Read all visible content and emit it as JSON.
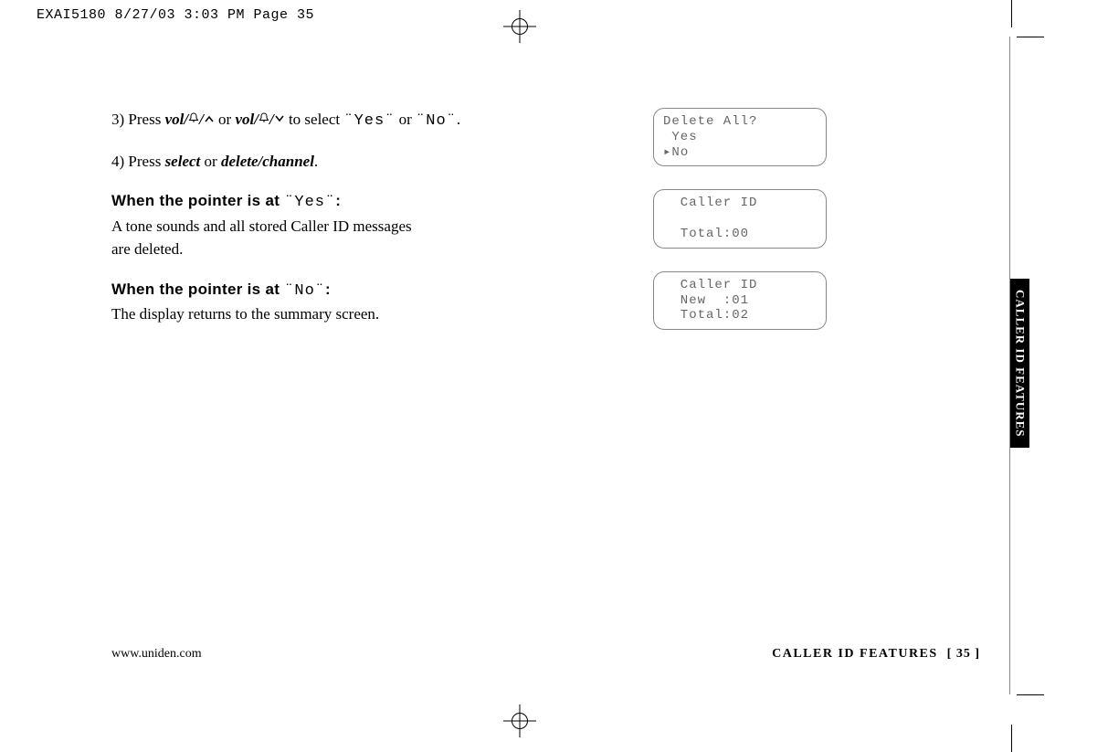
{
  "slug": "EXAI5180  8/27/03 3:03 PM  Page 35",
  "step3_prefix": "3) Press ",
  "vol_label": "vol/",
  "step3_mid": " or ",
  "step3_suffix_a": " to select ",
  "yes_q": "¨Yes¨",
  "or_word": " or ",
  "no_q": "¨No¨",
  "period": ".",
  "step4_prefix": "4) Press ",
  "select_word": "select",
  "step4_mid": " or ",
  "delchan": "delete/channel",
  "when_yes_head": "When the pointer is at ",
  "colon": ":",
  "when_yes_body1": "A tone sounds and all stored Caller ID messages",
  "when_yes_body2": "are deleted.",
  "when_no_head": "When the pointer is at ",
  "when_no_body": "The display returns to the summary screen.",
  "lcd1_l1": "Delete All?",
  "lcd1_l2": " Yes",
  "lcd1_l3": "▸No",
  "lcd2_l1": "  Caller ID",
  "lcd2_l2": "",
  "lcd2_l3": "  Total:00",
  "lcd3_l1": "  Caller ID",
  "lcd3_l2": "  New  :01",
  "lcd3_l3": "  Total:02",
  "side_tab": "CALLER ID FEATURES",
  "footer_left": "www.uniden.com",
  "footer_right_label": "CALLER ID FEATURES",
  "footer_page": "[ 35 ]"
}
